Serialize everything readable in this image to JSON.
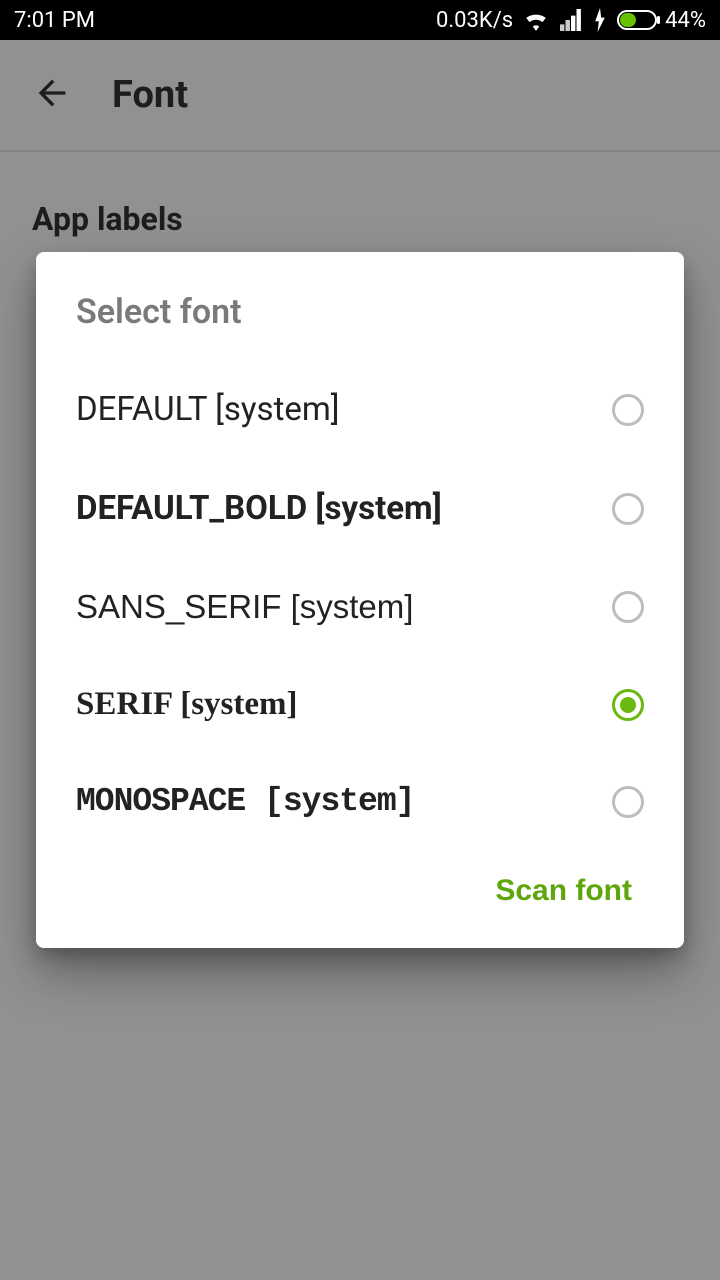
{
  "statusbar": {
    "time": "7:01 PM",
    "netrate": "0.03K/s",
    "battery_pct": "44%"
  },
  "header": {
    "title": "Font"
  },
  "section": {
    "title": "App labels"
  },
  "dialog": {
    "title": "Select font",
    "options": [
      {
        "label": "DEFAULT [system]"
      },
      {
        "label": "DEFAULT_BOLD [system]"
      },
      {
        "label": "SANS_SERIF [system]"
      },
      {
        "label": "SERIF [system]"
      },
      {
        "label": "MONOSPACE [system]"
      }
    ],
    "scan_button": "Scan font"
  }
}
